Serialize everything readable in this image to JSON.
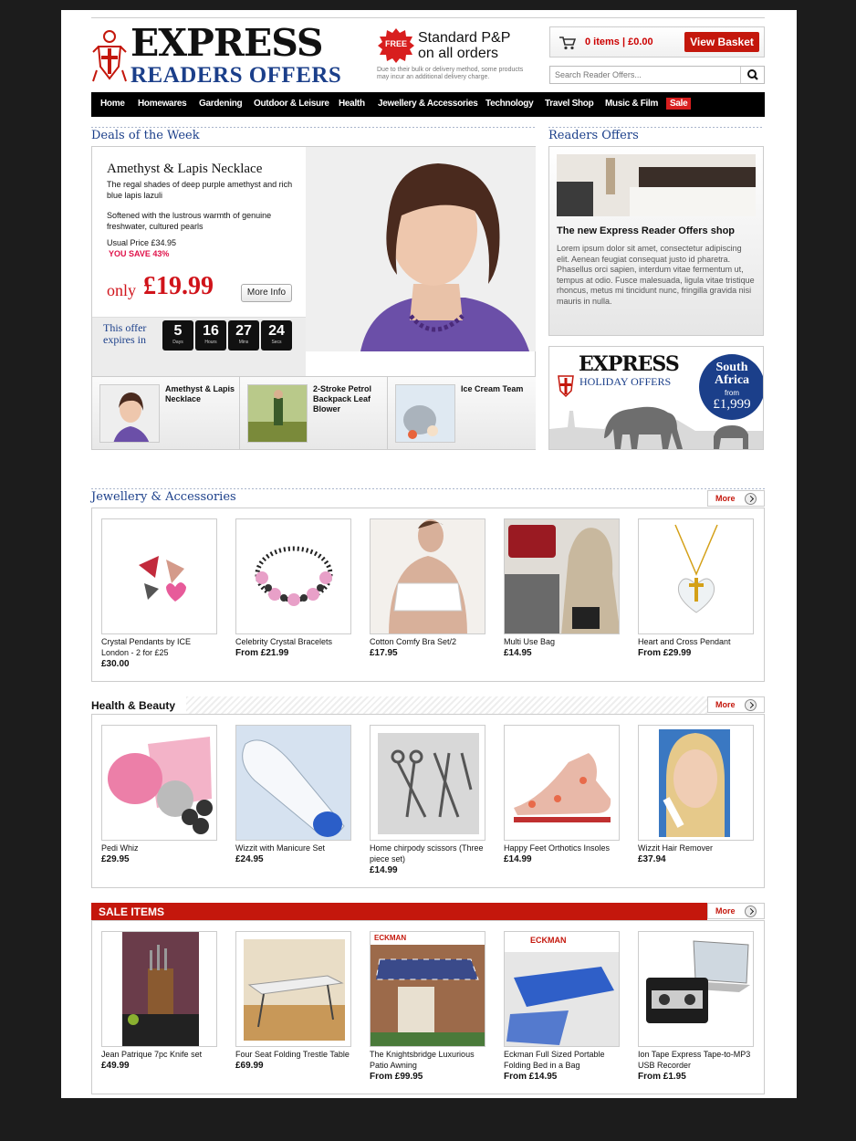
{
  "brand": {
    "line1": "EXPRESS",
    "line2": "READERS OFFERS"
  },
  "shipping": {
    "badge": "FREE",
    "line1": "Standard P&P",
    "line2": "on all orders",
    "note": "Due to their bulk or delivery method, some products may incur an additional delivery charge."
  },
  "basket": {
    "summary": "0 items | £0.00",
    "button": "View Basket"
  },
  "search": {
    "placeholder": "Search Reader Offers..."
  },
  "nav": [
    "Home",
    "Homewares",
    "Gardening",
    "Outdoor & Leisure",
    "Health",
    "Jewellery & Accessories",
    "Technology",
    "Travel Shop",
    "Music & Film",
    "Sale"
  ],
  "deals": {
    "section_title": "Deals of the Week",
    "title": "Amethyst & Lapis Necklace",
    "desc1": "The regal shades of deep purple amethyst and  rich blue lapis lazuli",
    "desc2": "Softened with the lustrous warmth of genuine freshwater, cultured pearls",
    "usual": "Usual Price £34.95",
    "save": "YOU SAVE 43%",
    "only": "only",
    "price": "£19.99",
    "more": "More Info",
    "expires": "This offer expires in",
    "countdown": [
      {
        "value": "5",
        "unit": "Days"
      },
      {
        "value": "16",
        "unit": "Hours"
      },
      {
        "value": "27",
        "unit": "Mins"
      },
      {
        "value": "24",
        "unit": "Secs"
      }
    ],
    "thumbs": [
      "Amethyst & Lapis Necklace",
      "2-Stroke Petrol Backpack Leaf Blower",
      "Ice Cream Team"
    ]
  },
  "readers": {
    "section_title": "Readers Offers",
    "heading": "The new Express Reader Offers shop",
    "body": "Lorem ipsum dolor sit amet, consectetur adipiscing elit. Aenean feugiat consequat justo id pharetra. Phasellus orci sapien, interdum vitae fermentum ut, tempus at odio. Fusce malesuada, ligula vitae tristique rhoncus, metus mi tincidunt nunc, fringilla gravida nisi mauris in nulla."
  },
  "holiday": {
    "line1": "EXPRESS",
    "line2": "HOLIDAY OFFERS",
    "dest": "South Africa",
    "from": "from",
    "price": "£1,999"
  },
  "jewellery": {
    "title": "Jewellery & Accessories",
    "more": "More",
    "items": [
      {
        "name": "Crystal Pendants by ICE London - 2 for £25",
        "price": "£30.00"
      },
      {
        "name": "Celebrity Crystal Bracelets",
        "price": "From £21.99"
      },
      {
        "name": "Cotton Comfy Bra Set/2",
        "price": "£17.95"
      },
      {
        "name": "Multi Use Bag",
        "price": "£14.95"
      },
      {
        "name": "Heart and Cross Pendant",
        "price": "From £29.99"
      }
    ]
  },
  "health": {
    "title": "Health & Beauty",
    "more": "More",
    "items": [
      {
        "name": "Pedi Whiz",
        "price": "£29.95"
      },
      {
        "name": "Wizzit with Manicure Set",
        "price": "£24.95"
      },
      {
        "name": "Home chirpody scissors (Three piece set)",
        "price": "£14.99"
      },
      {
        "name": "Happy Feet Orthotics Insoles",
        "price": "£14.99"
      },
      {
        "name": "Wizzit Hair Remover",
        "price": "£37.94"
      }
    ]
  },
  "sale": {
    "title": "SALE ITEMS",
    "more": "More",
    "items": [
      {
        "name": "Jean Patrique 7pc Knife set",
        "price": "£49.99"
      },
      {
        "name": "Four Seat Folding Trestle Table",
        "price": "£69.99"
      },
      {
        "name": "The Knightsbridge Luxurious Patio Awning",
        "price": "From £99.95"
      },
      {
        "name": "Eckman Full Sized Portable Folding Bed in a Bag",
        "price": "From £14.95"
      },
      {
        "name": "Ion Tape Express Tape-to-MP3 USB Recorder",
        "price": "From £1.95"
      }
    ],
    "eckman": "ECKMAN"
  },
  "colors": {
    "brand_blue": "#1b3f8a",
    "accent_red": "#c4170c",
    "nav_bg": "#000000"
  }
}
